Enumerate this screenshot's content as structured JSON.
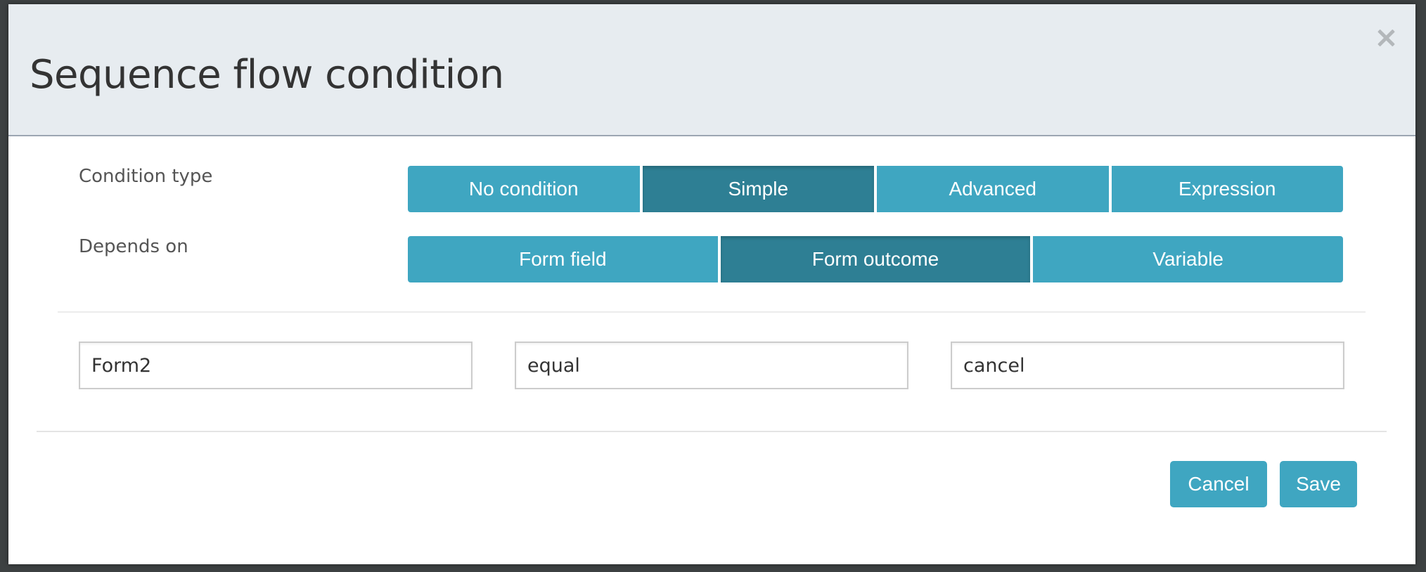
{
  "dialog": {
    "title": "Sequence flow condition",
    "close_icon": "close-icon"
  },
  "condition_type": {
    "label": "Condition type",
    "options": [
      "No condition",
      "Simple",
      "Advanced",
      "Expression"
    ],
    "selected": "Simple"
  },
  "depends_on": {
    "label": "Depends on",
    "options": [
      "Form field",
      "Form outcome",
      "Variable"
    ],
    "selected": "Form outcome"
  },
  "condition": {
    "form": "Form2",
    "operator": "equal",
    "value": "cancel"
  },
  "footer": {
    "cancel_label": "Cancel",
    "save_label": "Save"
  },
  "colors": {
    "primary": "#3fa6c1",
    "active": "#2e7f94",
    "header_bg": "#e7ecf0"
  }
}
